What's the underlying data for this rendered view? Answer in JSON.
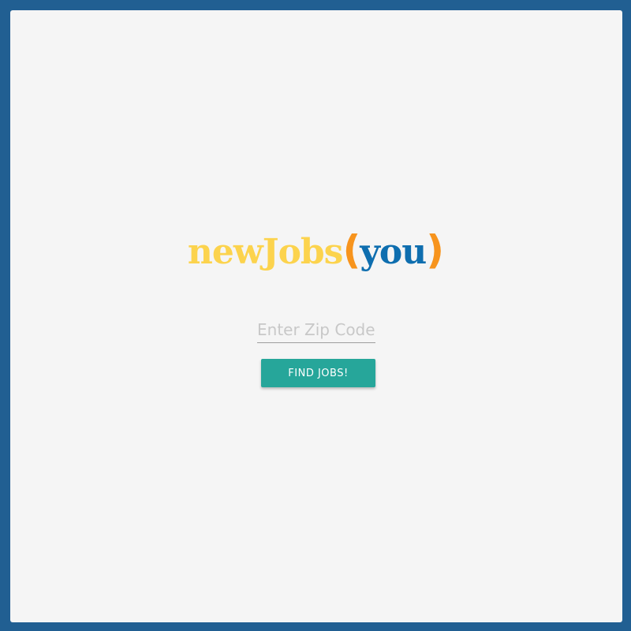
{
  "logo": {
    "part1": "newJobs",
    "paren_open": "(",
    "part2": "you",
    "paren_close": ")",
    "colors": {
      "new_jobs": "#fcd34d",
      "parens": "#f7941d",
      "you": "#0e6eaf"
    }
  },
  "search": {
    "placeholder": "Enter Zip Code",
    "value": ""
  },
  "button": {
    "label": "FIND JOBS!",
    "color": "#26a69a"
  },
  "theme": {
    "border_color": "#215f92",
    "background": "#f5f5f5"
  }
}
